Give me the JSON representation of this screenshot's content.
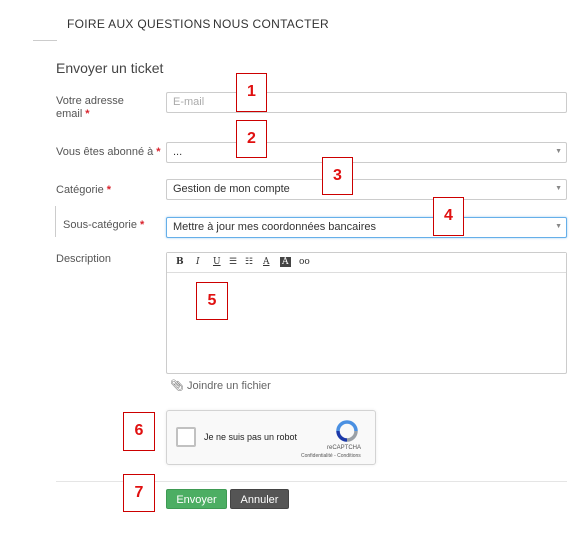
{
  "nav": {
    "faq": "FOIRE AUX QUESTIONS",
    "contact": "NOUS CONTACTER"
  },
  "form": {
    "title": "Envoyer un ticket",
    "required_mark": "*",
    "email_label_1": "Votre adresse",
    "email_label_2": "email",
    "email_placeholder": "E-mail",
    "subscribed_label": "Vous êtes abonné à",
    "subscribed_value": "...",
    "category_label": "Catégorie",
    "category_value": "Gestion de mon compte",
    "subcategory_label": "Sous-catégorie",
    "subcategory_value": "Mettre à jour mes coordonnées bancaires",
    "description_label": "Description",
    "attach_label": "Joindre un fichier",
    "captcha_text": "Je ne suis pas un robot",
    "captcha_brand": "reCAPTCHA",
    "captcha_terms": "Confidentialité - Conditions",
    "send_label": "Envoyer",
    "cancel_label": "Annuler"
  },
  "toolbar": {
    "bold": "B",
    "italic": "I",
    "underline": "U",
    "bullets": "☰",
    "numbers": "☷",
    "font": "A",
    "color": "A",
    "link": "oo"
  },
  "annotations": [
    "1",
    "2",
    "3",
    "4",
    "5",
    "6",
    "7"
  ],
  "colors": {
    "primary": "#4cae63",
    "secondary": "#555555",
    "annotation": "#e01010",
    "required": "#d9232d"
  }
}
